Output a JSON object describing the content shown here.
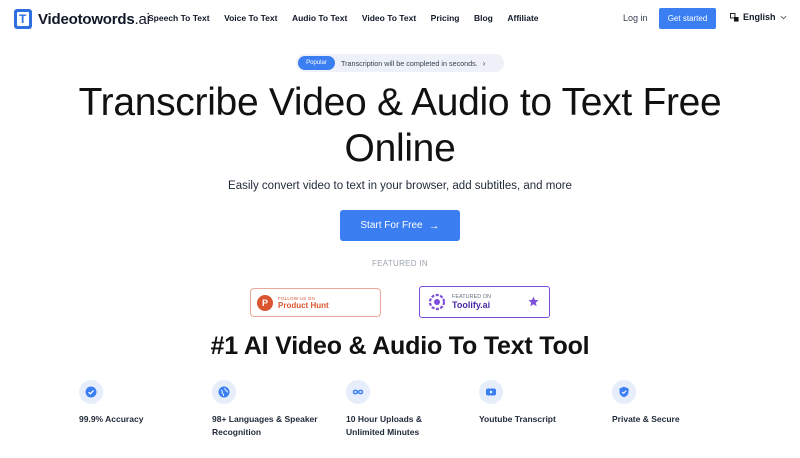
{
  "nav": {
    "logo_main": "Videotowords",
    "logo_suffix": ".ai",
    "links": [
      "Speech To Text",
      "Voice To Text",
      "Audio To Text",
      "Video To Text",
      "Pricing",
      "Blog",
      "Affiliate"
    ],
    "login": "Log in",
    "get_started": "Get started",
    "language": "English"
  },
  "badge": {
    "pill": "Popular",
    "text": "Transcription will be completed in seconds.",
    "arrow": "›"
  },
  "hero": {
    "title": "Transcribe Video & Audio to Text Free Online",
    "subtitle": "Easily convert video to text in your browser, add subtitles, and more",
    "cta": "Start For Free",
    "cta_arrow": "→"
  },
  "featured": {
    "label": "FEATURED IN",
    "product_hunt": {
      "logo_letter": "P",
      "small": "FOLLOW US ON",
      "big": "Product Hunt"
    },
    "toolify": {
      "small": "FEATURED ON",
      "big": "Toolify.ai"
    }
  },
  "section_title": "#1 AI Video & Audio To Text Tool",
  "features": [
    {
      "icon": "check-badge-icon",
      "label": "99.9% Accuracy"
    },
    {
      "icon": "globe-icon",
      "label": "98+ Languages & Speaker Recognition"
    },
    {
      "icon": "infinity-icon",
      "label": "10 Hour Uploads & Unlimited Minutes"
    },
    {
      "icon": "youtube-icon",
      "label": "Youtube Transcript"
    },
    {
      "icon": "shield-check-icon",
      "label": "Private & Secure"
    }
  ],
  "colors": {
    "primary": "#3b7ef2",
    "product_hunt": "#da552f",
    "toolify": "#7c4ddb",
    "icon_bg": "#e6eefc"
  }
}
